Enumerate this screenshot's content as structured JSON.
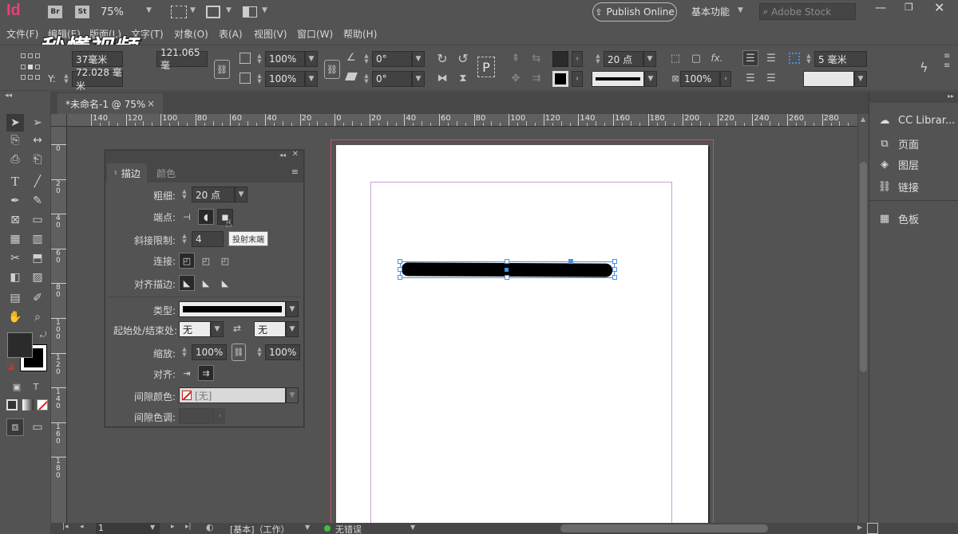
{
  "app": {
    "logo": "Id",
    "bridge_badge": "Br",
    "stock_badge": "St",
    "zoom": "75%",
    "publish_label": "Publish Online",
    "workspace_label": "基本功能",
    "search_placeholder": "Adobe Stock",
    "watermark": "秒懂视频"
  },
  "menu": [
    "文件(F)",
    "编辑(E)",
    "版面(L)",
    "文字(T)",
    "对象(O)",
    "表(A)",
    "视图(V)",
    "窗口(W)",
    "帮助(H)"
  ],
  "control": {
    "x_label": "X:",
    "x_value": "37毫米",
    "y_label": "Y:",
    "y_value": "72.028 毫米",
    "w_value": "121.065 毫",
    "scale_x": "100%",
    "scale_y": "100%",
    "angle": "0°",
    "shear": "0°",
    "p_glyph": "P",
    "stroke_weight": "20 点",
    "opacity": "100%",
    "gap": "5 毫米"
  },
  "doc_tab": {
    "title": "*未命名-1 @ 75%",
    "close": "×"
  },
  "ruler": {
    "h_ticks": [
      "140",
      "120",
      "100",
      "80",
      "60",
      "40",
      "20",
      "0",
      "20",
      "40",
      "60",
      "80",
      "100",
      "120",
      "140",
      "160",
      "180",
      "200",
      "220",
      "240",
      "260",
      "280"
    ],
    "v_ticks": [
      "0",
      "2\n0",
      "4\n0",
      "6\n0",
      "8\n0",
      "1\n0\n0",
      "1\n2\n0",
      "1\n4\n0",
      "1\n6\n0",
      "1\n8\n0"
    ]
  },
  "stroke_panel": {
    "tab_stroke": "描边",
    "tab_color": "颜色",
    "weight_label": "粗细:",
    "weight_value": "20 点",
    "cap_label": "端点:",
    "tooltip": "投射末端",
    "miter_label": "斜接限制:",
    "miter_value": "4",
    "join_label": "连接:",
    "align_label": "对齐描边:",
    "type_label": "类型:",
    "startend_label": "起始处/结束处:",
    "start_value": "无",
    "end_value": "无",
    "scale_label": "缩放:",
    "scale_start": "100%",
    "scale_end": "100%",
    "align2_label": "对齐:",
    "gap_color_label": "间隙颜色:",
    "gap_color_value": "[无]",
    "gap_tint_label": "间隙色调:"
  },
  "right_panel": {
    "items": [
      "CC Librar...",
      "页面",
      "图层",
      "链接",
      "色板"
    ]
  },
  "status": {
    "page": "1",
    "style": "[基本]（工作）",
    "errors": "无错误"
  },
  "colors": {
    "accent_blue": "#4a90e2",
    "margin_magenta": "#c66ec6",
    "bleed_red": "#c8515f",
    "status_green": "#3fbf3f",
    "logo_pink": "#e6417e"
  }
}
